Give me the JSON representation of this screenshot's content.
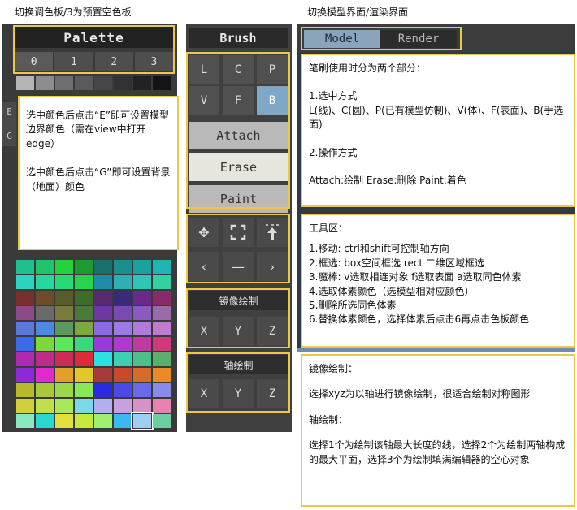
{
  "captions": {
    "left": "切换调色板/3为预置空色板",
    "right": "切换模型界面/渲染界面"
  },
  "palette": {
    "title": "Palette",
    "tabs": [
      "0",
      "1",
      "2",
      "3"
    ],
    "edge_key": "E",
    "ground_key": "G",
    "note": {
      "line1": "选中颜色后点击“E”即可设置模型边界颜色（需在view中打开edge）",
      "line2": "选中颜色后点击“G”即可设置背景（地面）颜色"
    },
    "grays": [
      "#b4b4b4",
      "#8c8c8c",
      "#6e6e6e",
      "#5a5a5a",
      "#464646",
      "#323232",
      "#222222",
      "#141414"
    ],
    "rows": [
      [
        "#1fbf8f",
        "#21c46b",
        "#24d23a",
        "#1e9a30",
        "#1a6e6e",
        "#198f8f",
        "#1aa0a0",
        "#1fb5b5"
      ],
      [
        "#2cd3c3",
        "#2ad6a0",
        "#28d977",
        "#29d44a",
        "#1f8ba5",
        "#2eb0b0",
        "#2ec7b4",
        "#35d0a0"
      ],
      [
        "#7a2f2f",
        "#6e4b2a",
        "#5a5a2a",
        "#3a6e2a",
        "#5a2a6e",
        "#3a2a7a",
        "#6a2a8a",
        "#8a2a6a"
      ],
      [
        "#8a4a8a",
        "#6a6a6a",
        "#7a7a3a",
        "#4a7a3a",
        "#6a3aa0",
        "#7a4ab0",
        "#8a5ac0",
        "#9a6aaa"
      ],
      [
        "#5a7ad8",
        "#4a8ae0",
        "#5a9a5a",
        "#7aaa3a",
        "#8a6ae0",
        "#9a7ae8",
        "#b07ae0",
        "#c07ad0"
      ],
      [
        "#3a6ae8",
        "#7ad83a",
        "#5ae85a",
        "#3ad87a",
        "#9a3ad8",
        "#b03ad0",
        "#c03aa0",
        "#d03a7a"
      ],
      [
        "#b02ab0",
        "#c02a8a",
        "#d02a5a",
        "#e02a3a",
        "#2ae0e0",
        "#3ad0b0",
        "#4ac08a",
        "#5ab06a"
      ],
      [
        "#8a2ad8",
        "#e02ad0",
        "#e0a02a",
        "#e0c82a",
        "#a83a3a",
        "#c84a2a",
        "#d86a2a",
        "#e88a2a"
      ],
      [
        "#b8b82a",
        "#a8c83a",
        "#98d84a",
        "#88e85a",
        "#2a2ae0",
        "#4a4ae8",
        "#6a6ae8",
        "#8a8ae8"
      ],
      [
        "#d0d03a",
        "#c0e04a",
        "#a8e85a",
        "#7ad8e8",
        "#b0b0f0",
        "#c8a0e0",
        "#d890c8",
        "#e880b0"
      ],
      [
        "#8ae8c0",
        "#2ad8d0",
        "#e0e03a",
        "#c8e83a",
        "#a0f070",
        "#3ab8f0",
        "#9fcdf3",
        "#6ad0a0"
      ]
    ],
    "selected_swatch": "#9fcdf3"
  },
  "brush": {
    "title": "Brush",
    "shapes": [
      "L",
      "C",
      "P",
      "V",
      "F",
      "B"
    ],
    "selected_shape": "B",
    "actions": [
      "Attach",
      "Erase",
      "Paint"
    ],
    "selected_action": "Erase",
    "tools_row1": [
      "move-icon",
      "box-select-icon",
      "magic-wand-icon"
    ],
    "tools_row2": [
      "arrow-left-icon",
      "minus-icon",
      "arrow-right-icon"
    ],
    "mirror": {
      "label": "镜像绘制",
      "axes": [
        "X",
        "Y",
        "Z"
      ]
    },
    "axis": {
      "label": "轴绘制",
      "axes": [
        "X",
        "Y",
        "Z"
      ]
    }
  },
  "mode_tabs": {
    "items": [
      "Model",
      "Render"
    ],
    "active": "Model"
  },
  "info": {
    "brush_usage": {
      "l1": "笔刷使用时分为两个部分：",
      "l2": "1.选中方式",
      "l3": "L(线)、C(圆)、P(已有模型仿制)、V(体)、F(表面)、B(手选面)",
      "l4": "2.操作方式",
      "l5": "Attach:绘制  Erase:删除  Paint:着色"
    },
    "tools": {
      "l1": "工具区：",
      "l2": "1.移动: ctrl和shift可控制轴方向",
      "l3": "2.框选: box空间框选 rect 二维区域框选",
      "l4": "3.魔棒: v选取相连对象 f选取表面 a选取同色体素",
      "l5": "4.选取体素颜色（选模型相对应颜色）",
      "l6": "5.删除所选同色体素",
      "l7": "6.替换体素颜色，选择体素后点击6再点击色板颜色"
    },
    "mirror": {
      "l1": "镜像绘制：",
      "l2": "选择xyz为以轴进行镜像绘制，很适合绘制对称图形",
      "l3": "轴绘制：",
      "l4": "选择1个为绘制该轴最大长度的线，选择2个为绘制两轴构成的最大平面，选择3个为绘制填满编辑器的空心对象"
    }
  }
}
